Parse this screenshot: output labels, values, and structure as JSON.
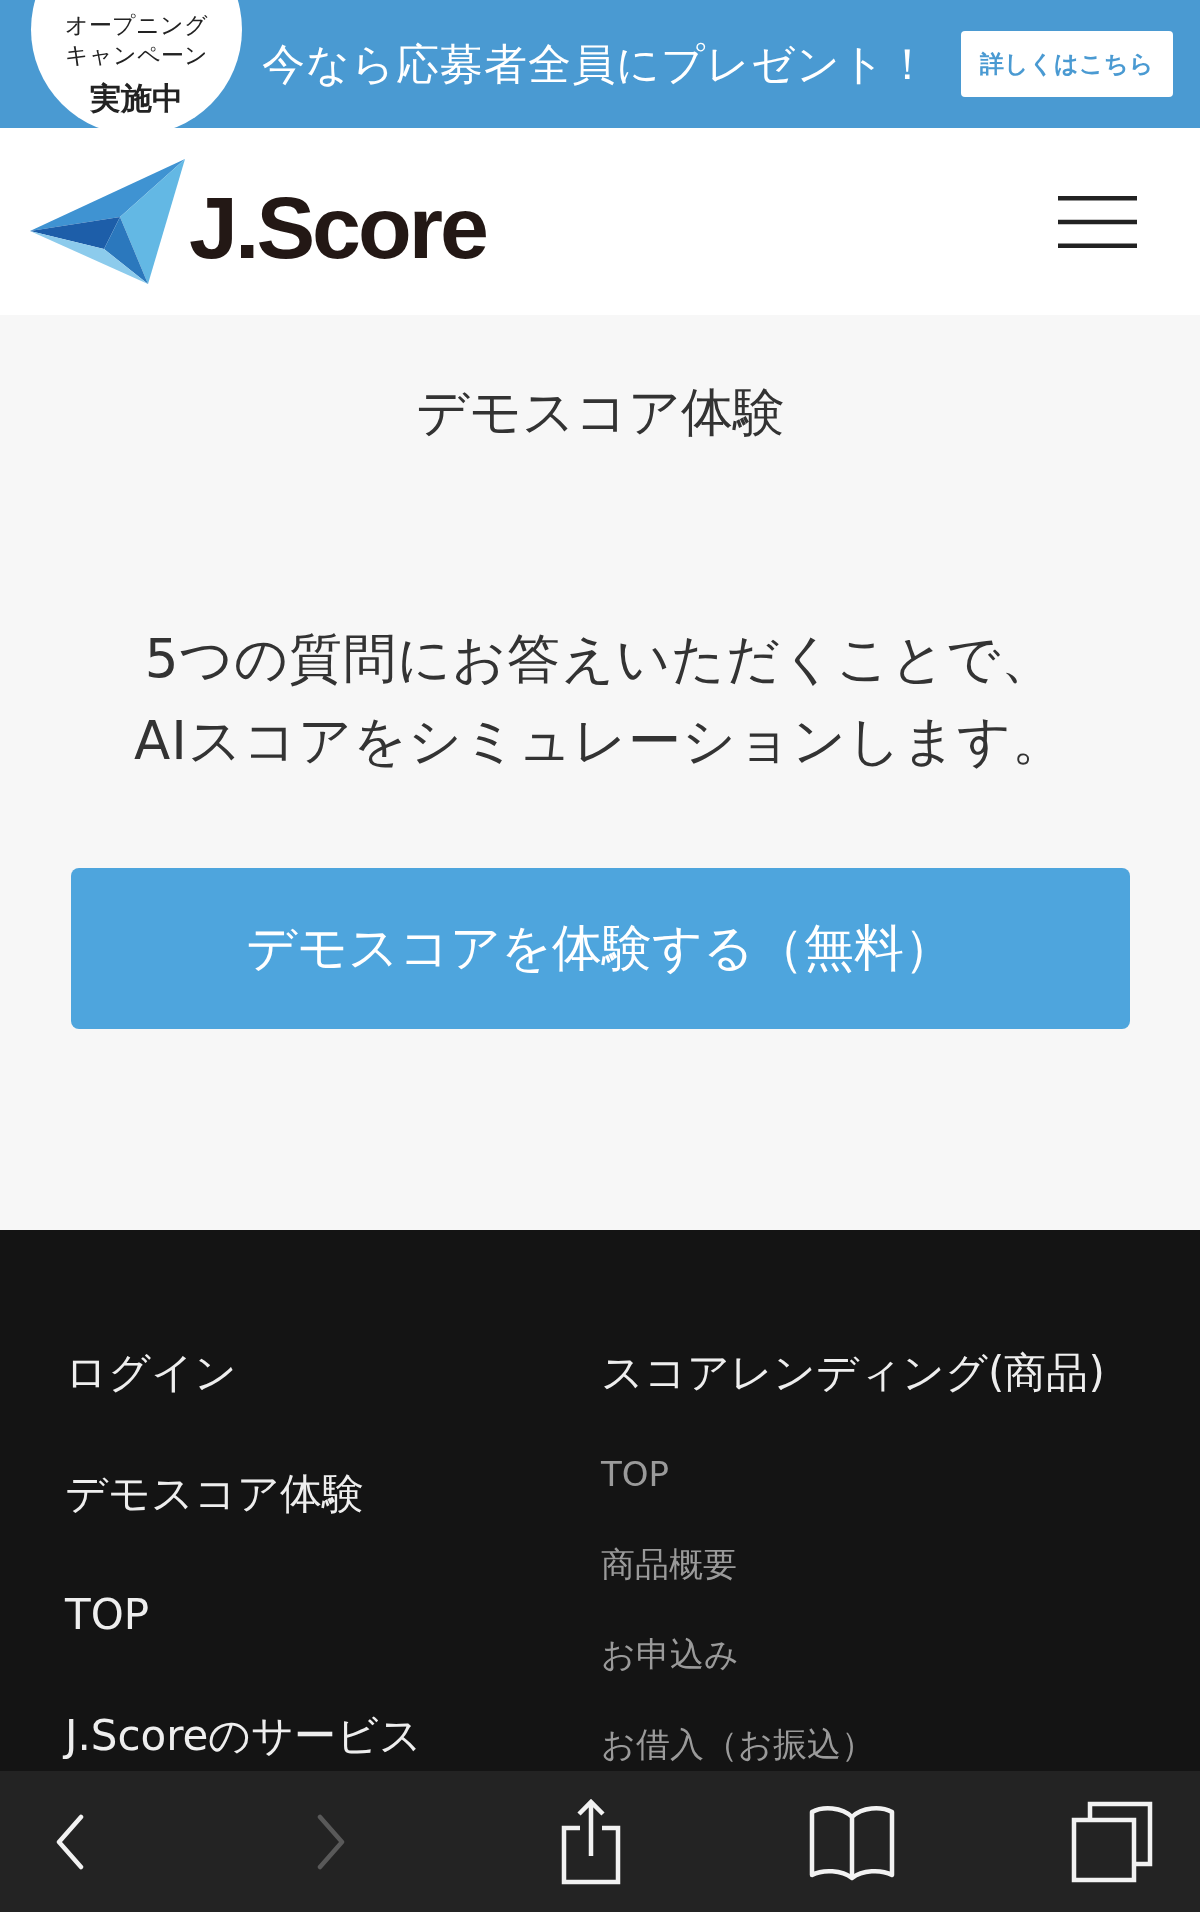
{
  "promo_banner": {
    "badge_lines": [
      {
        "text": "オープニング",
        "kind": "small"
      },
      {
        "text": "キャンペーン",
        "kind": "small"
      },
      {
        "text": "実施中",
        "kind": "large"
      }
    ],
    "message": "今なら応募者全員にプレゼント！",
    "button": "詳しくはこちら"
  },
  "header": {
    "logo_text": "J.Score"
  },
  "demo_section": {
    "title": "デモスコア体験",
    "description_lines": [
      "5つの質問にお答えいただくことで、",
      "AIスコアをシミュレーションします。"
    ],
    "button": "デモスコアを体験する（無料）"
  },
  "footer": {
    "left_links": [
      "ログイン",
      "デモスコア体験",
      "TOP",
      "J.Scoreのサービス"
    ],
    "right_column": {
      "heading": "スコアレンディング(商品)",
      "links": [
        "TOP",
        "商品概要",
        "お申込み",
        "お借入（お振込）"
      ]
    }
  },
  "browser_toolbar": {
    "buttons": [
      {
        "kind": "back",
        "disabled": false
      },
      {
        "kind": "forward",
        "disabled": true
      },
      {
        "kind": "share",
        "disabled": false
      },
      {
        "kind": "bookmarks",
        "disabled": false
      },
      {
        "kind": "tabs",
        "disabled": false
      }
    ]
  }
}
